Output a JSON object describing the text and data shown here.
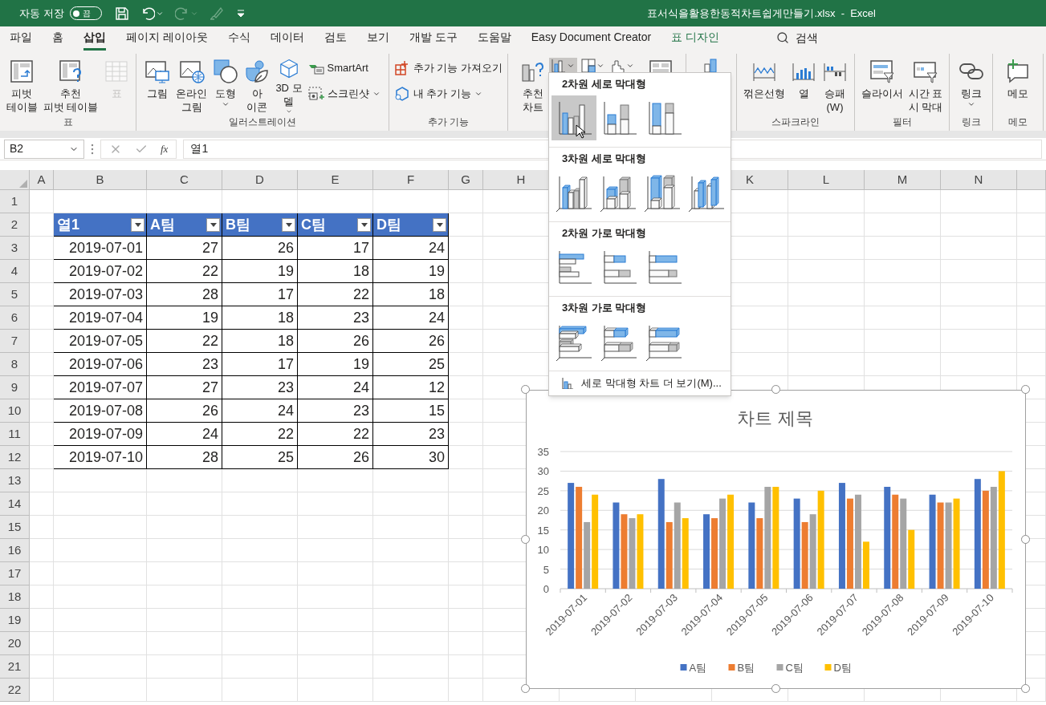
{
  "title_bar": {
    "autosave_label": "자동 저장",
    "autosave_toggle": {
      "on": false,
      "label": "끔"
    },
    "quick_access": [
      {
        "kind": "save",
        "disabled": false
      },
      {
        "kind": "undo",
        "disabled": false
      },
      {
        "kind": "redo",
        "disabled": true
      },
      {
        "kind": "brush",
        "disabled": true
      },
      {
        "kind": "customize",
        "disabled": false
      }
    ],
    "title": "표서식을활용한동적차트쉽게만들기.xlsx  -  Excel"
  },
  "tabs": [
    {
      "label": "파일",
      "selected": false,
      "kind": "normal"
    },
    {
      "label": "홈",
      "selected": false,
      "kind": "normal"
    },
    {
      "label": "삽입",
      "selected": true,
      "kind": "normal"
    },
    {
      "label": "페이지 레이아웃",
      "selected": false,
      "kind": "normal"
    },
    {
      "label": "수식",
      "selected": false,
      "kind": "normal"
    },
    {
      "label": "데이터",
      "selected": false,
      "kind": "normal"
    },
    {
      "label": "검토",
      "selected": false,
      "kind": "normal"
    },
    {
      "label": "보기",
      "selected": false,
      "kind": "normal"
    },
    {
      "label": "개발 도구",
      "selected": false,
      "kind": "normal"
    },
    {
      "label": "도움말",
      "selected": false,
      "kind": "normal"
    },
    {
      "label": "Easy Document Creator",
      "selected": false,
      "kind": "normal"
    },
    {
      "label": "표 디자인",
      "selected": false,
      "kind": "contextual"
    }
  ],
  "search": {
    "label": "검색"
  },
  "ribbon": {
    "groups": [
      {
        "label": "표",
        "items": [
          {
            "kind": "large",
            "label": "피벗\n테이블",
            "disabled": false,
            "dropdown": false
          },
          {
            "kind": "large",
            "label": "추천\n피벗 테이블",
            "disabled": false,
            "dropdown": false
          },
          {
            "kind": "large",
            "label": "표",
            "disabled": true,
            "dropdown": false
          }
        ]
      },
      {
        "label": "일러스트레이션",
        "items": [
          {
            "kind": "large",
            "label": "그림",
            "disabled": false,
            "dropdown": false
          },
          {
            "kind": "large",
            "label": "온라인\n그림",
            "disabled": false,
            "dropdown": false
          },
          {
            "kind": "large",
            "label": "도형",
            "disabled": false,
            "dropdown": true
          },
          {
            "kind": "large",
            "label": "아\n이콘",
            "disabled": false,
            "dropdown": false
          },
          {
            "kind": "large",
            "label": "3D 모\n델",
            "disabled": false,
            "dropdown": true
          },
          {
            "kind": "small",
            "label": "SmartArt",
            "disabled": false,
            "dropdown": false
          },
          {
            "kind": "small",
            "label": "스크린샷",
            "disabled": false,
            "dropdown": true
          }
        ]
      },
      {
        "label": "추가 기능",
        "items": [
          {
            "kind": "small",
            "label": "추가 기능 가져오기",
            "disabled": false,
            "dropdown": false
          },
          {
            "kind": "small",
            "label": "내 추가 기능",
            "disabled": false,
            "dropdown": true
          }
        ]
      },
      {
        "items": [
          {
            "kind": "large",
            "label": "추천\n차트",
            "disabled": false,
            "dropdown": false
          },
          {
            "kind": "split",
            "disabled": false,
            "expanded": true
          },
          {
            "kind": "split",
            "disabled": false,
            "expanded": false
          },
          {
            "kind": "split",
            "disabled": false,
            "expanded": false
          },
          {
            "kind": "large",
            "disabled": false,
            "dropdown": false
          }
        ]
      },
      {
        "items": [
          {
            "kind": "large",
            "disabled": false,
            "dropdown": false
          }
        ]
      },
      {
        "label": "스파크라인",
        "items": [
          {
            "kind": "large",
            "label": "꺾은선형",
            "disabled": false,
            "dropdown": false
          },
          {
            "kind": "large",
            "label": "열",
            "disabled": false,
            "dropdown": false
          },
          {
            "kind": "large",
            "label": "승패\n(W)",
            "disabled": false,
            "dropdown": false
          }
        ]
      },
      {
        "label": "필터",
        "items": [
          {
            "kind": "large",
            "label": "슬라이서",
            "disabled": false,
            "dropdown": false
          },
          {
            "kind": "large",
            "label": "시간 표\n시 막대",
            "disabled": false,
            "dropdown": false
          }
        ]
      },
      {
        "label": "링크",
        "items": [
          {
            "kind": "large",
            "label": "링크",
            "disabled": false,
            "dropdown": true
          }
        ]
      },
      {
        "label": "메모",
        "items": [
          {
            "kind": "large",
            "label": "메모",
            "disabled": false,
            "dropdown": false
          }
        ]
      }
    ]
  },
  "formula_bar": {
    "name_box": "B2",
    "function_label": "fx",
    "formula": "열1"
  },
  "sheet": {
    "column_headers": [
      "A",
      "B",
      "C",
      "D",
      "E",
      "F",
      "G",
      "H",
      "K",
      "L",
      "M",
      "N"
    ],
    "row_headers": [
      "1",
      "2",
      "3",
      "4",
      "5",
      "6",
      "7",
      "8",
      "9",
      "10",
      "11",
      "12",
      "13",
      "14",
      "15",
      "16",
      "17",
      "18",
      "19",
      "20",
      "21",
      "22"
    ],
    "table": {
      "columns": [
        {
          "label": "열1"
        },
        {
          "label": "A팀"
        },
        {
          "label": "B팀"
        },
        {
          "label": "C팀"
        },
        {
          "label": "D팀"
        }
      ],
      "rows": [
        [
          "2019-07-01",
          "27",
          "26",
          "17",
          "24"
        ],
        [
          "2019-07-02",
          "22",
          "19",
          "18",
          "19"
        ],
        [
          "2019-07-03",
          "28",
          "17",
          "22",
          "18"
        ],
        [
          "2019-07-04",
          "19",
          "18",
          "23",
          "24"
        ],
        [
          "2019-07-05",
          "22",
          "18",
          "26",
          "26"
        ],
        [
          "2019-07-06",
          "23",
          "17",
          "19",
          "25"
        ],
        [
          "2019-07-07",
          "27",
          "23",
          "24",
          "12"
        ],
        [
          "2019-07-08",
          "26",
          "24",
          "23",
          "15"
        ],
        [
          "2019-07-09",
          "24",
          "22",
          "22",
          "23"
        ],
        [
          "2019-07-10",
          "28",
          "25",
          "26",
          "30"
        ]
      ]
    }
  },
  "chart": {
    "chart_data": {
      "type": "bar",
      "title": "차트 제목",
      "categories": [
        "2019-07-01",
        "2019-07-02",
        "2019-07-03",
        "2019-07-04",
        "2019-07-05",
        "2019-07-06",
        "2019-07-07",
        "2019-07-08",
        "2019-07-09",
        "2019-07-10"
      ],
      "series": [
        {
          "name": "A팀",
          "color": "#4472c4",
          "values": [
            27,
            22,
            28,
            19,
            22,
            23,
            27,
            26,
            24,
            28
          ]
        },
        {
          "name": "B팀",
          "color": "#ed7d31",
          "values": [
            26,
            19,
            17,
            18,
            18,
            17,
            23,
            24,
            22,
            25
          ]
        },
        {
          "name": "C팀",
          "color": "#a5a5a5",
          "values": [
            17,
            18,
            22,
            23,
            26,
            19,
            24,
            23,
            22,
            26
          ]
        },
        {
          "name": "D팀",
          "color": "#ffc000",
          "values": [
            24,
            19,
            18,
            24,
            26,
            25,
            12,
            15,
            23,
            30
          ]
        }
      ],
      "ylim": [
        0,
        35
      ],
      "yticks": [
        {
          "value": 0,
          "label": "0"
        },
        {
          "value": 5,
          "label": "5"
        },
        {
          "value": 10,
          "label": "10"
        },
        {
          "value": 15,
          "label": "15"
        },
        {
          "value": 20,
          "label": "20"
        },
        {
          "value": 25,
          "label": "25"
        },
        {
          "value": 30,
          "label": "30"
        },
        {
          "value": 35,
          "label": "35"
        }
      ],
      "grid": true,
      "legend": true
    }
  },
  "chart_menu": {
    "sections": [
      {
        "title": "2차원 세로 막대형",
        "kind": "column-2d",
        "items": [
          {
            "kind": "clustered",
            "selected": true
          },
          {
            "kind": "stacked",
            "selected": false
          },
          {
            "kind": "percent",
            "selected": false
          }
        ]
      },
      {
        "title": "3차원 세로 막대형",
        "kind": "column-3d",
        "items": [
          {
            "kind": "clustered",
            "selected": false
          },
          {
            "kind": "stacked",
            "selected": false
          },
          {
            "kind": "percent",
            "selected": false
          },
          {
            "kind": "depth",
            "selected": false
          }
        ]
      },
      {
        "title": "2차원 가로 막대형",
        "kind": "bar-2d",
        "items": [
          {
            "kind": "clustered",
            "selected": false
          },
          {
            "kind": "stacked",
            "selected": false
          },
          {
            "kind": "percent",
            "selected": false
          }
        ]
      },
      {
        "title": "3차원 가로 막대형",
        "kind": "bar-3d",
        "items": [
          {
            "kind": "clustered",
            "selected": false
          },
          {
            "kind": "stacked",
            "selected": false
          },
          {
            "kind": "percent",
            "selected": false
          }
        ]
      }
    ],
    "footer": "세로 막대형 차트 더 보기(M)..."
  }
}
